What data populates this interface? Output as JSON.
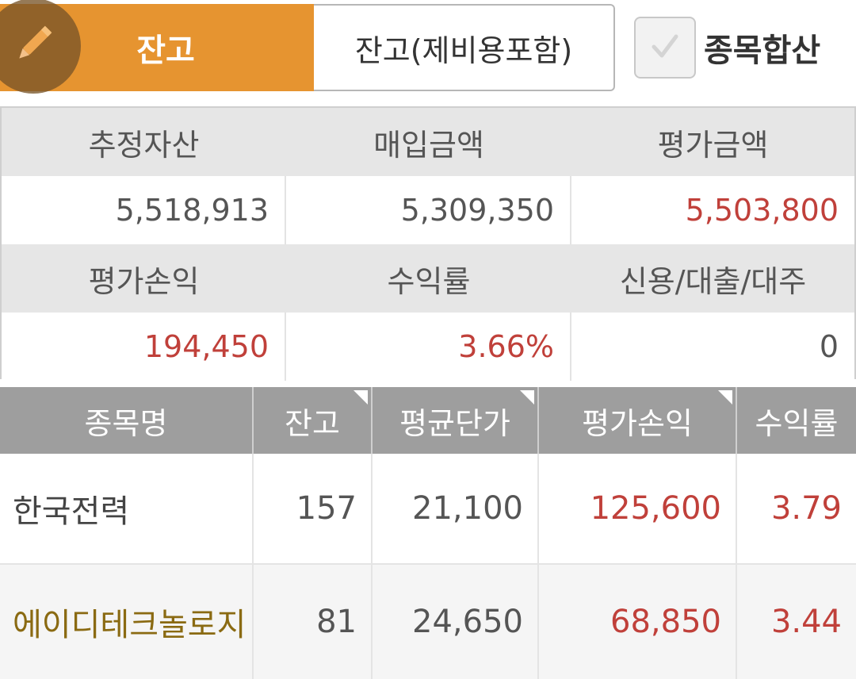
{
  "topbar": {
    "tab_balance": "잔고",
    "tab_balance_with_fees": "잔고(제비용포함)",
    "combine_checkbox_label": "종목합산",
    "combine_checked": true,
    "colors": {
      "active_tab": "#e69430",
      "edit_fab": "#7a5628"
    }
  },
  "summary": {
    "headers_row1": [
      "추정자산",
      "매입금액",
      "평가금액"
    ],
    "values_row1": [
      "5,518,913",
      "5,309,350",
      "5,503,800"
    ],
    "headers_row2": [
      "평가손익",
      "수익률",
      "신용/대출/대주"
    ],
    "values_row2": [
      "194,450",
      "3.66%",
      "0"
    ],
    "positive_color": "#c0403a"
  },
  "holdings": {
    "columns": [
      "종목명",
      "잔고",
      "평균단가",
      "평가손익",
      "수익률"
    ],
    "rows": [
      {
        "name": "한국전력",
        "qty": "157",
        "avg_price": "21,100",
        "pnl": "125,600",
        "return": "3.79"
      },
      {
        "name": "에이디테크놀로지",
        "qty": "81",
        "avg_price": "24,650",
        "pnl": "68,850",
        "return": "3.44"
      }
    ]
  }
}
